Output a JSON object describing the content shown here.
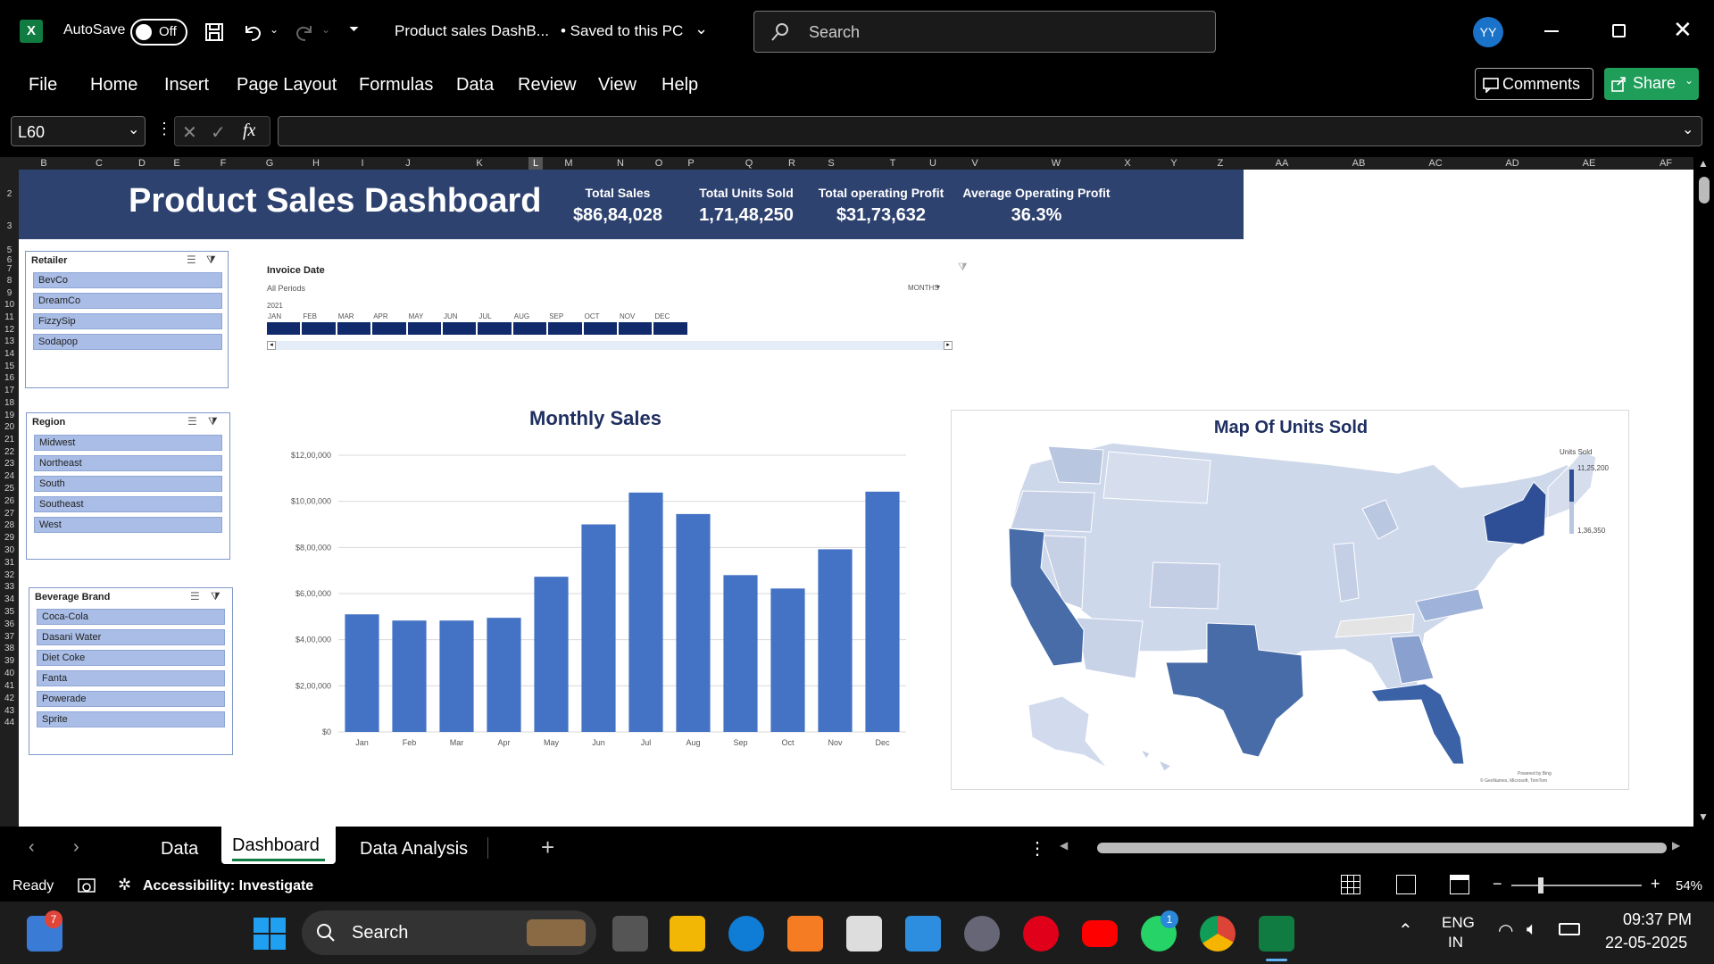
{
  "titlebar": {
    "autosave_label": "AutoSave",
    "autosave_state": "Off",
    "doc_title": "Product sales DashB...",
    "saved_status": "• Saved to this PC",
    "search_placeholder": "Search",
    "avatar_initials": "YY"
  },
  "menu": {
    "items": [
      "File",
      "Home",
      "Insert",
      "Page Layout",
      "Formulas",
      "Data",
      "Review",
      "View",
      "Help"
    ],
    "comments_label": "Comments",
    "share_label": "Share"
  },
  "formula": {
    "name_box": "L60",
    "fx_label": "fx",
    "content": ""
  },
  "columns": [
    "B",
    "C",
    "D",
    "E",
    "F",
    "G",
    "H",
    "I",
    "J",
    "K",
    "L",
    "M",
    "N",
    "O",
    "P",
    "Q",
    "R",
    "S",
    "T",
    "U",
    "V",
    "W",
    "X",
    "Y",
    "Z",
    "AA",
    "AB",
    "AC",
    "AD",
    "AE",
    "AF"
  ],
  "rows": [
    "2",
    "3",
    "5",
    "6",
    "7",
    "8",
    "9",
    "10",
    "11",
    "12",
    "13",
    "14",
    "15",
    "16",
    "17",
    "18",
    "19",
    "20",
    "21",
    "22",
    "23",
    "24",
    "25",
    "26",
    "27",
    "28",
    "29",
    "30",
    "31",
    "32",
    "33",
    "34",
    "35",
    "36",
    "37",
    "38",
    "39",
    "40",
    "41",
    "42",
    "43",
    "44"
  ],
  "dashboard": {
    "title": "Product Sales Dashboard",
    "kpis": [
      {
        "label": "Total Sales",
        "value": "$86,84,028"
      },
      {
        "label": "Total Units Sold",
        "value": "1,71,48,250"
      },
      {
        "label": "Total operating Profit",
        "value": "$31,73,632"
      },
      {
        "label": "Average Operating Profit",
        "value": "36.3%"
      }
    ]
  },
  "slicers": {
    "retailer": {
      "title": "Retailer",
      "items": [
        "BevCo",
        "DreamCo",
        "FizzySip",
        "Sodapop"
      ]
    },
    "region": {
      "title": "Region",
      "items": [
        "Midwest",
        "Northeast",
        "South",
        "Southeast",
        "West"
      ]
    },
    "brand": {
      "title": "Beverage Brand",
      "items": [
        "Coca-Cola",
        "Dasani Water",
        "Diet Coke",
        "Fanta",
        "Powerade",
        "Sprite"
      ]
    }
  },
  "timeline": {
    "title": "Invoice Date",
    "period": "All Periods",
    "level": "MONTHS",
    "year": "2021",
    "months": [
      "JAN",
      "FEB",
      "MAR",
      "APR",
      "MAY",
      "JUN",
      "JUL",
      "AUG",
      "SEP",
      "OCT",
      "NOV",
      "DEC"
    ]
  },
  "chart_data": {
    "type": "bar",
    "title": "Monthly Sales",
    "xlabel": "",
    "ylabel": "",
    "categories": [
      "Jan",
      "Feb",
      "Mar",
      "Apr",
      "May",
      "Jun",
      "Jul",
      "Aug",
      "Sep",
      "Oct",
      "Nov",
      "Dec"
    ],
    "values": [
      510000,
      483000,
      483000,
      495000,
      673000,
      900000,
      1038000,
      945000,
      680000,
      622000,
      792000,
      1042000
    ],
    "ylim": [
      0,
      1200000
    ],
    "yticks": [
      "$0",
      "$2,00,000",
      "$4,00,000",
      "$6,00,000",
      "$8,00,000",
      "$10,00,000",
      "$12,00,000"
    ],
    "grid": true,
    "color": "#4472c4"
  },
  "map": {
    "title": "Map Of Units Sold",
    "legend_title": "Units Sold",
    "legend_max": "11,25,200",
    "legend_min": "1,36,350",
    "credit1": "Powered by Bing",
    "credit2": "© GeoNames, Microsoft, TomTom"
  },
  "sheets": {
    "tabs": [
      "Data",
      "Dashboard",
      "Data Analysis"
    ],
    "active": "Dashboard"
  },
  "status": {
    "ready": "Ready",
    "accessibility": "Accessibility: Investigate",
    "zoom": "54%"
  },
  "taskbar": {
    "search_label": "Search",
    "lang1": "ENG",
    "lang2": "IN",
    "time": "09:37 PM",
    "date": "22-05-2025",
    "badge_widgets": "7",
    "badge_whatsapp": "1"
  },
  "colors": {
    "header_navy": "#2e4270",
    "bar_blue": "#4472c4",
    "slicer_item": "#a9bde6",
    "excel_green": "#107c41"
  }
}
